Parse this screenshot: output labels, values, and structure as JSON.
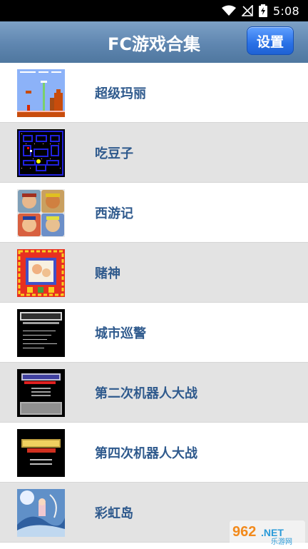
{
  "status_bar": {
    "time": "5:08"
  },
  "header": {
    "title": "FC游戏合集",
    "settings_label": "设置"
  },
  "games": [
    {
      "name": "超级玛丽"
    },
    {
      "name": "吃豆子"
    },
    {
      "name": "西游记"
    },
    {
      "name": "赌神"
    },
    {
      "name": "城市巡警"
    },
    {
      "name": "第二次机器人大战"
    },
    {
      "name": "第四次机器人大战"
    },
    {
      "name": "彩虹岛"
    }
  ],
  "watermark": {
    "text": "962.NET 乐游网"
  }
}
